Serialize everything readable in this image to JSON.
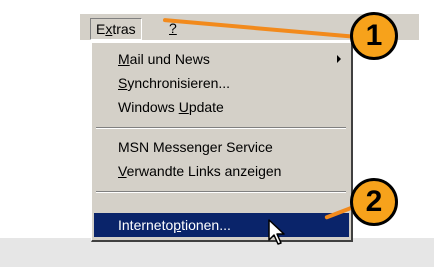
{
  "menubar": {
    "extras_parts": [
      "E",
      "x",
      "tras"
    ],
    "help_label": "?"
  },
  "dropdown": {
    "items": [
      {
        "parts": [
          "",
          "M",
          "ail und News"
        ],
        "has_submenu": true
      },
      {
        "parts": [
          "",
          "S",
          "ynchronisieren..."
        ]
      },
      {
        "parts": [
          "Windows ",
          "U",
          "pdate"
        ]
      },
      {
        "parts": [
          "MSN Messenger Service",
          "",
          ""
        ]
      },
      {
        "parts": [
          "",
          "V",
          "erwandte Links anzeigen"
        ]
      },
      {
        "parts": [
          "Interneto",
          "p",
          "tionen..."
        ],
        "selected": true
      }
    ]
  },
  "callouts": [
    {
      "number": "1"
    },
    {
      "number": "2"
    }
  ],
  "colors": {
    "menu_bg": "#d4d0c8",
    "highlight": "#0a246a",
    "callout": "#f7a21b",
    "callout_line": "#f28a1c"
  },
  "icons": {
    "cursor": "mouse-pointer-icon",
    "submenu": "chevron-right-icon"
  }
}
